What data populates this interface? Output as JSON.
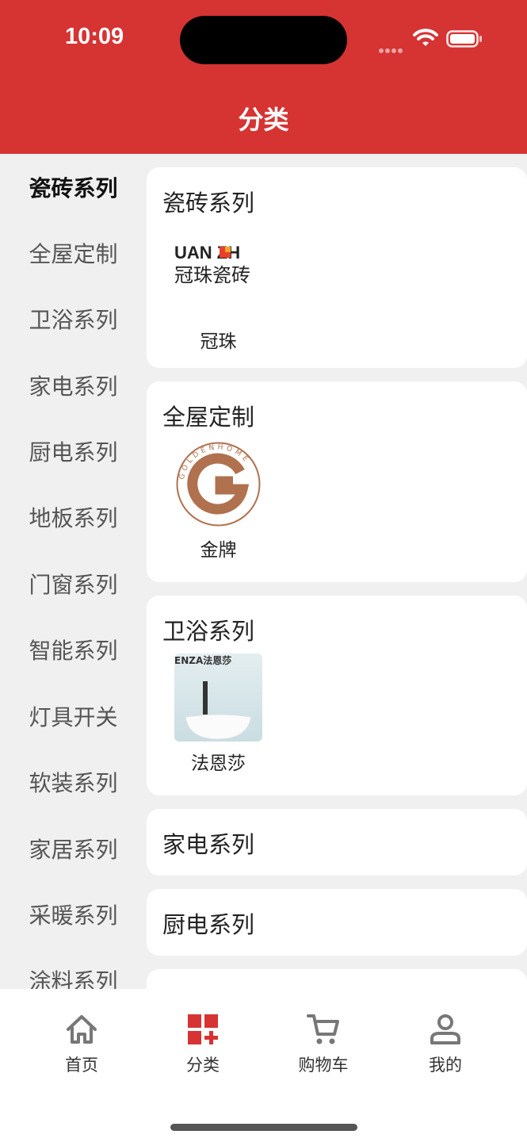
{
  "status_bar": {
    "time": "10:09"
  },
  "header": {
    "title": "分类"
  },
  "sidebar": {
    "items": [
      {
        "label": "瓷砖系列",
        "active": true
      },
      {
        "label": "全屋定制"
      },
      {
        "label": "卫浴系列"
      },
      {
        "label": "家电系列"
      },
      {
        "label": "厨电系列"
      },
      {
        "label": "地板系列"
      },
      {
        "label": "门窗系列"
      },
      {
        "label": "智能系列"
      },
      {
        "label": "灯具开关"
      },
      {
        "label": "软装系列"
      },
      {
        "label": "家居系列"
      },
      {
        "label": "采暖系列"
      },
      {
        "label": "涂料系列"
      }
    ]
  },
  "content": {
    "sections": [
      {
        "title": "瓷砖系列",
        "brands": [
          {
            "name": "冠珠",
            "logo_text": "UAN ZH",
            "logo_subtext": "冠珠瓷砖"
          }
        ]
      },
      {
        "title": "全屋定制",
        "brands": [
          {
            "name": "金牌",
            "logo_text": "GOLDENHOME",
            "logo_letter": "G"
          }
        ]
      },
      {
        "title": "卫浴系列",
        "brands": [
          {
            "name": "法恩莎",
            "logo_text": "ENZA法恩莎"
          }
        ]
      },
      {
        "title": "家电系列",
        "brands": []
      },
      {
        "title": "厨电系列",
        "brands": []
      }
    ]
  },
  "tabbar": {
    "tabs": [
      {
        "label": "首页",
        "icon": "home-icon"
      },
      {
        "label": "分类",
        "icon": "category-icon",
        "active": true
      },
      {
        "label": "购物车",
        "icon": "cart-icon"
      },
      {
        "label": "我的",
        "icon": "profile-icon"
      }
    ]
  },
  "colors": {
    "brand_red": "#d63333",
    "background": "#f0f0f0",
    "logo_brown": "#b0714e"
  }
}
